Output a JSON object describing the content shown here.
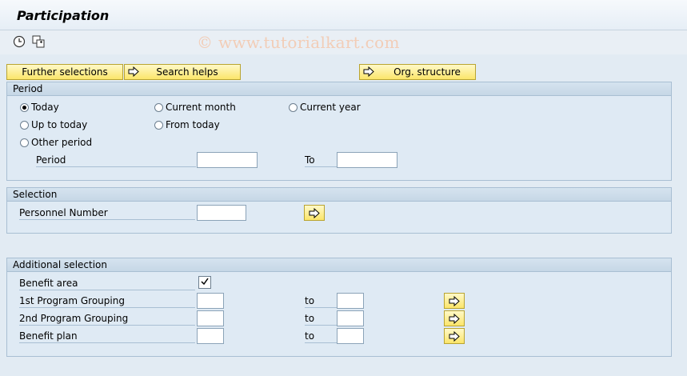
{
  "window": {
    "title": "Participation"
  },
  "toolbar": {
    "icons": [
      "execute-clock-icon",
      "multiple-selection-icon"
    ]
  },
  "watermark": "© www.tutorialkart.com",
  "buttons": {
    "further_selections": "Further selections",
    "search_helps": "Search helps",
    "org_structure": "Org. structure"
  },
  "period": {
    "header": "Period",
    "options": {
      "today": "Today",
      "current_month": "Current month",
      "current_year": "Current year",
      "up_to_today": "Up to today",
      "from_today": "From today",
      "other_period": "Other period"
    },
    "selected": "Today",
    "period_label": "Period",
    "to_label": "To",
    "period_from": "",
    "period_to": ""
  },
  "selection": {
    "header": "Selection",
    "personnel_number_label": "Personnel Number",
    "personnel_number_value": ""
  },
  "additional": {
    "header": "Additional selection",
    "benefit_area_label": "Benefit area",
    "benefit_area_checked": true,
    "rows": [
      {
        "label": "1st Program Grouping",
        "to": "to",
        "from_value": "",
        "to_value": ""
      },
      {
        "label": "2nd Program Grouping",
        "to": "to",
        "from_value": "",
        "to_value": ""
      },
      {
        "label": "Benefit plan",
        "to": "to",
        "from_value": "",
        "to_value": ""
      }
    ]
  },
  "colors": {
    "button_yellow": "#fbe56a",
    "panel": "#dfeaf4",
    "background": "#e2ebf3"
  }
}
